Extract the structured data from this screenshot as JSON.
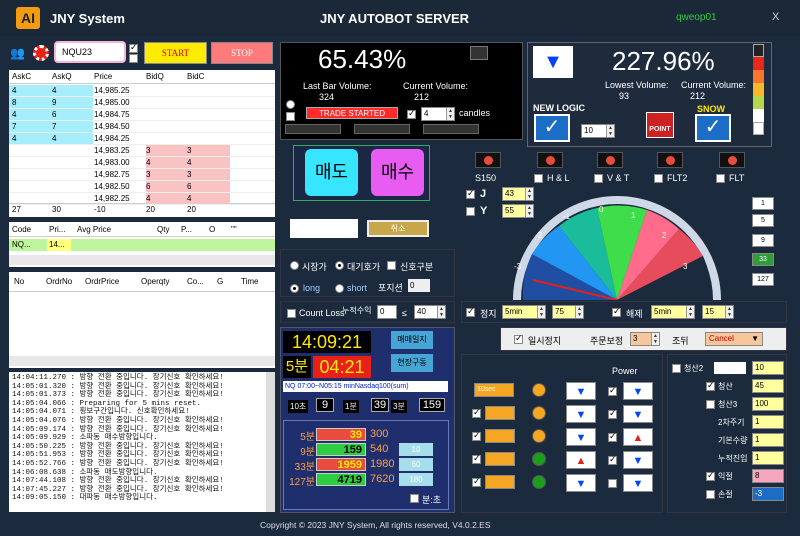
{
  "header": {
    "logo": "AI",
    "app_name": "JNY System",
    "server_title": "JNY AUTOBOT SERVER",
    "user": "qweop01",
    "close": "X"
  },
  "controls": {
    "symbol": "NQU23",
    "start": "START",
    "stop": "STOP"
  },
  "orderbook": {
    "headers": [
      "AskC",
      "AskQ",
      "Price",
      "BidQ",
      "BidC"
    ],
    "rows": [
      [
        "4",
        "4",
        "14,985.25",
        "",
        ""
      ],
      [
        "8",
        "9",
        "14,985.00",
        "",
        ""
      ],
      [
        "4",
        "6",
        "14,984.75",
        "",
        ""
      ],
      [
        "7",
        "7",
        "14,984.50",
        "",
        ""
      ],
      [
        "4",
        "4",
        "14,984.25",
        "",
        ""
      ],
      [
        "",
        "",
        "14,983.25",
        "3",
        "3"
      ],
      [
        "",
        "",
        "14,983.00",
        "4",
        "4"
      ],
      [
        "",
        "",
        "14,982.75",
        "3",
        "3"
      ],
      [
        "",
        "",
        "14,982.50",
        "6",
        "6"
      ],
      [
        "",
        "",
        "14,982.25",
        "4",
        "4"
      ]
    ],
    "totals": [
      "27",
      "30",
      "-10",
      "20",
      "20"
    ]
  },
  "position": {
    "headers": [
      "Code",
      "Pri...",
      "Avg Price",
      "Qty",
      "P...",
      "O",
      "\"\""
    ],
    "row": [
      "NQ...",
      "14..."
    ]
  },
  "orders": {
    "headers": [
      "No",
      "OrdrNo",
      "OrdrPrice",
      "Operqty",
      "Co...",
      "G",
      "Time"
    ]
  },
  "log": [
    "14:04:11.270 : 방향 전환 중입니다. 장기신호 확인하세요!",
    "14:05:01.320 : 방향 전환 중입니다. 장기신호 확인하세요!",
    "14:05:01.373 : 방향 전환 중입니다. 장기신호 확인하세요!",
    "14:05:04.066 : Preparing for 5 mins reset.",
    "14:05:04.071 : 횡보구간입니다. 신호확인하세요!",
    "14:05:04.076 : 방향 전환 중입니다. 장기신호 확인하세요!",
    "14:05:09.174 : 방향 전환 중입니다. 장기신호 확인하세요!",
    "14:05:09.929 : 소파동 매수방향입니다.",
    "14:05:50.225 : 방향 전환 중입니다. 장기신호 확인하세요!",
    "14:05:51.953 : 방향 전환 중입니다. 장기신호 확인하세요!",
    "14:05:52.766 : 방향 전환 중입니다. 장기신호 확인하세요!",
    "14:06:08.638 : 소파동 매도방향입니다.",
    "14:07:44.108 : 방향 전환 중입니다. 장기신호 확인하세요!",
    "14:07:45.227 : 방향 전환 중입니다. 장기신호 확인하세요!",
    "14:09:05.150 : 대파동 매수방향입니다."
  ],
  "volume_panel": {
    "pct": "65.43%",
    "last_lbl": "Last Bar Volume:",
    "last_val": "324",
    "cur_lbl": "Current Volume:",
    "cur_val": "212",
    "trade_btn": "TRADE STARTED",
    "candles_val": "4",
    "candles_lbl": "candles"
  },
  "big_panel": {
    "pct": "227.96%",
    "low_lbl": "Lowest Volume:",
    "low_val": "93",
    "cur_lbl": "Current Volume:",
    "cur_val": "212",
    "new_logic": "NEW LOGIC",
    "new_logic_val": "10",
    "snow": "SNOW",
    "point": "POINT"
  },
  "trade_buttons": {
    "sell": "매도",
    "buy": "매수",
    "cancel": "취소"
  },
  "leds": [
    {
      "name": "S150"
    },
    {
      "name": "H & L"
    },
    {
      "name": "V & T"
    },
    {
      "name": "FLT2"
    },
    {
      "name": "FLT"
    }
  ],
  "jy": {
    "j_lbl": "J",
    "j_val": "43",
    "y_lbl": "Y",
    "y_val": "55"
  },
  "gauge": {
    "ticks": [
      "-3",
      "-2",
      "-1",
      "0",
      "1",
      "2",
      "3"
    ]
  },
  "gauge_side": [
    "1",
    "5",
    "9",
    "33",
    "127"
  ],
  "market_opts": {
    "market": "시장가",
    "pending": "대기호가",
    "signal": "신호구분",
    "long": "long",
    "short": "short",
    "pos_lbl": "포지션",
    "pos_val": "0"
  },
  "count_loss": {
    "lbl": "Count Loss",
    "cum_lbl": "누적수익",
    "val1": "0",
    "val2": "40"
  },
  "clock": {
    "time": "14:09:21",
    "tf": "5분",
    "countdown": "04:21",
    "btn_sell": "매매일지",
    "btn_price": "현장구동",
    "ticker": "NQ 07:00~N05:15 minNasdaq100(sum)"
  },
  "ticks_row": [
    {
      "lbl": "10초",
      "val": "9"
    },
    {
      "lbl": "1분",
      "val": "39"
    },
    {
      "lbl": "3분",
      "val": "159"
    }
  ],
  "bars": [
    {
      "lbl": "5분",
      "val": "39",
      "val2": "300",
      "color": "#e74c3c"
    },
    {
      "lbl": "9분",
      "val": "159",
      "val2": "540",
      "color": "#2ecc40"
    },
    {
      "lbl": "33분",
      "val": "1959",
      "val2": "1980",
      "color": "#e74c3c"
    },
    {
      "lbl": "127분",
      "val": "4719",
      "val2": "7620",
      "color": "#2ecc40"
    }
  ],
  "bars_side": [
    "10",
    "60",
    "180"
  ],
  "bars_chk": "분:초",
  "stop_row": {
    "stop_lbl": "정지",
    "stop_tf": "5min",
    "stop_val": "75",
    "release_lbl": "해제",
    "release_tf": "5min",
    "release_val": "15"
  },
  "pause": {
    "lbl": "일시정지",
    "adj_lbl": "주문보정",
    "adj_val": "3",
    "cond_lbl": "조뒤",
    "select": "Cancel"
  },
  "power": {
    "lbl": "Power",
    "first_sel": "10sec"
  },
  "right_list": [
    {
      "lbl": "청산2",
      "val": "10"
    },
    {
      "lbl": "청산",
      "val": "45"
    },
    {
      "lbl": "청산3",
      "val": "100"
    },
    {
      "lbl": "2차주기",
      "val": "1"
    },
    {
      "lbl": "기본수량",
      "val": "1"
    },
    {
      "lbl": "누적진입",
      "val": "1"
    },
    {
      "lbl": "익절",
      "val": "8"
    },
    {
      "lbl": "손절",
      "val": "-3"
    }
  ],
  "footer": "Copyright © 2023 JNY System, All rights reserved, V4.0.2.ES"
}
